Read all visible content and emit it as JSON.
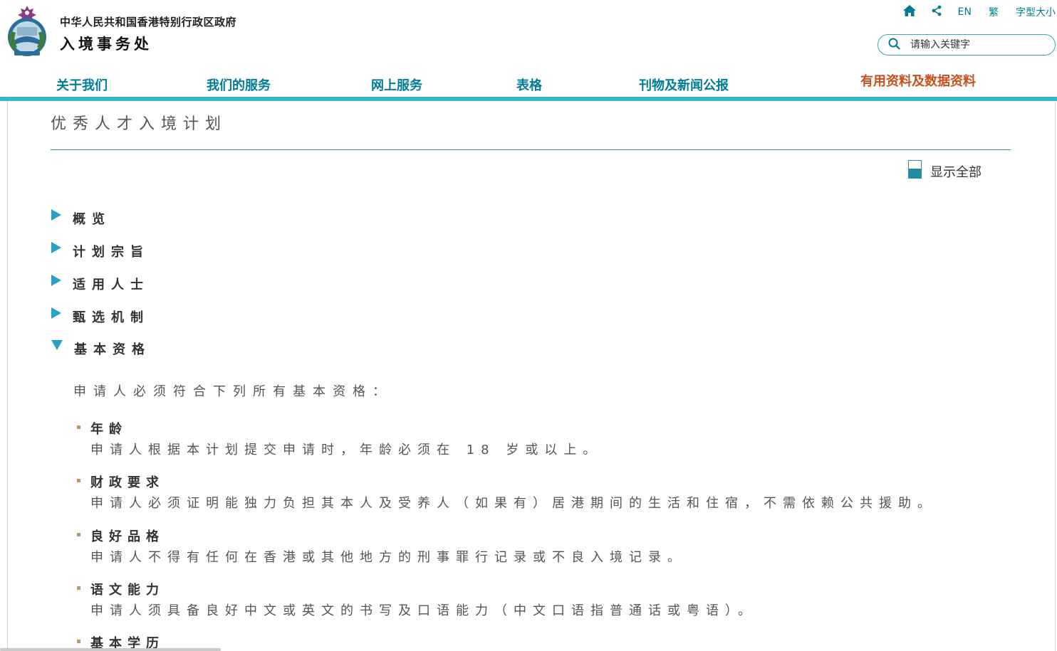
{
  "header": {
    "gov_title": "中华人民共和国香港特别行政区政府",
    "dept_title": "入境事务处",
    "tools": {
      "home_icon": "home-icon",
      "share_icon": "share-icon",
      "lang_en": "EN",
      "lang_tc": "繁",
      "font_size": "字型大小"
    },
    "search": {
      "placeholder": "请输入关键字",
      "value": ""
    }
  },
  "nav": {
    "items": [
      {
        "label": "关于我们"
      },
      {
        "label": "我们的服务"
      },
      {
        "label": "网上服务"
      },
      {
        "label": "表格"
      },
      {
        "label": "刊物及新闻公报"
      },
      {
        "label": "有用资料及数据资料"
      }
    ]
  },
  "content": {
    "page_title": "优秀人才入境计划",
    "show_all_label": "显示全部",
    "sections": [
      {
        "label": "概览",
        "expanded": false
      },
      {
        "label": "计划宗旨",
        "expanded": false
      },
      {
        "label": "适用人士",
        "expanded": false
      },
      {
        "label": "甄选机制",
        "expanded": false
      },
      {
        "label": "基本资格",
        "expanded": true
      }
    ],
    "intro": "申请人必须符合下列所有基本资格：",
    "requirements": [
      {
        "title": "年龄",
        "desc": "申请人根据本计划提交申请时，年龄必须在 18 岁或以上。"
      },
      {
        "title": "财政要求",
        "desc": "申请人必须证明能独力负担其本人及受养人（如果有）居港期间的生活和住宿，不需依赖公共援助。"
      },
      {
        "title": "良好品格",
        "desc": "申请人不得有任何在香港或其他地方的刑事罪行记录或不良入境记录。"
      },
      {
        "title": "语文能力",
        "desc": "申请人须具备良好中文或英文的书写及口语能力（中文口语指普通话或粤语）。"
      },
      {
        "title": "基本学历",
        "desc": ""
      }
    ]
  },
  "colors": {
    "teal": "#007c97",
    "nav_bar": "#36b5cc",
    "highlight": "#c8501e",
    "bullet": "#b8996a"
  }
}
